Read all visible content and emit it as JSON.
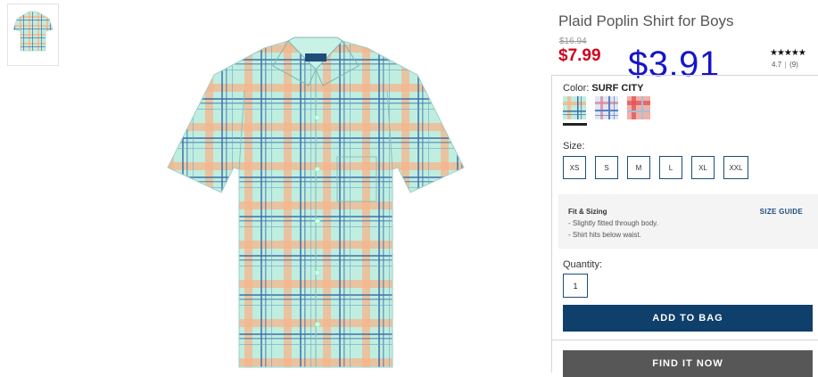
{
  "product": {
    "title": "Plaid Poplin Shirt for Boys",
    "original_price": "$16.94",
    "sale_price": "$7.99",
    "overlay_price": "$3.91",
    "stars": "★★★★★",
    "rating": "4.7",
    "review_count": "(9)"
  },
  "color": {
    "label": "Color:",
    "selected": "SURF CITY",
    "swatches": [
      "surf-city",
      "blue-red-plaid",
      "red-plaid"
    ]
  },
  "size": {
    "label": "Size:",
    "options": [
      "XS",
      "S",
      "M",
      "L",
      "XL",
      "XXL"
    ]
  },
  "fit": {
    "title": "Fit & Sizing",
    "guide_link": "SIZE GUIDE",
    "lines": [
      "- Slightly fitted through body.",
      "- Shirt hits below waist."
    ]
  },
  "quantity": {
    "label": "Quantity:",
    "value": "1"
  },
  "actions": {
    "add_to_bag": "ADD TO BAG",
    "find_it_now": "FIND IT NOW"
  },
  "colors": {
    "sale_red": "#d0021b",
    "overlay_blue": "#1515c8",
    "primary_navy": "#0f3f6b",
    "secondary_gray": "#575757",
    "plaid_base": "#bfeee0",
    "plaid_orange": "#f7b48a",
    "plaid_blue": "#3d6fa8"
  }
}
